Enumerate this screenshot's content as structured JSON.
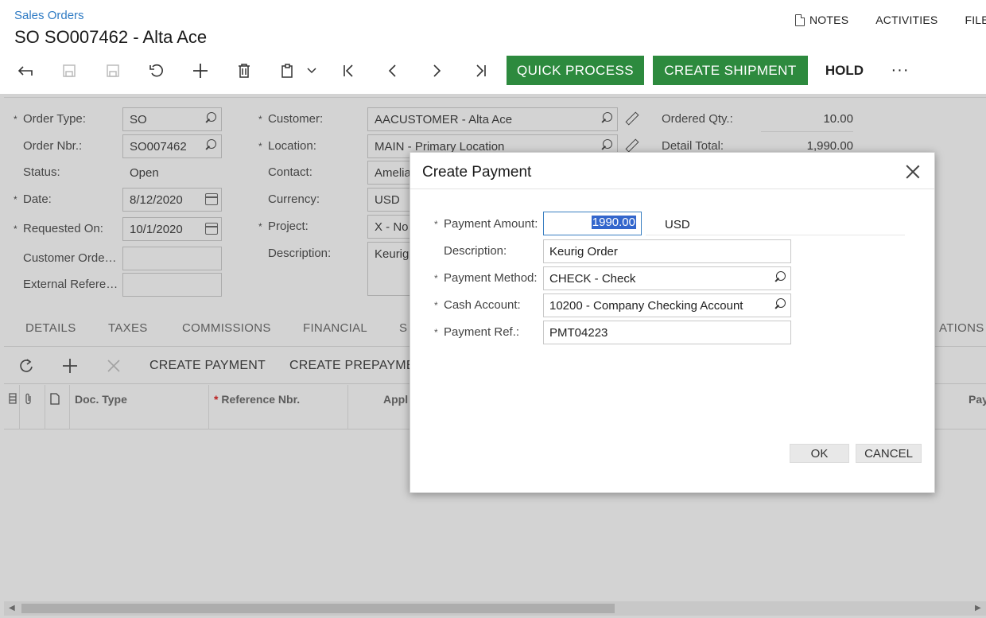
{
  "header": {
    "breadcrumb": "Sales Orders",
    "title": "SO SO007462 - Alta Ace",
    "links": {
      "notes": "NOTES",
      "activities": "ACTIVITIES",
      "files": "FILES"
    }
  },
  "toolbar": {
    "quick_process": "QUICK PROCESS",
    "create_shipment": "CREATE SHIPMENT",
    "hold": "HOLD",
    "more": "···"
  },
  "form": {
    "order_type_label": "Order Type:",
    "order_type": "SO",
    "order_nbr_label": "Order Nbr.:",
    "order_nbr": "SO007462",
    "status_label": "Status:",
    "status": "Open",
    "date_label": "Date:",
    "date": "8/12/2020",
    "requested_on_label": "Requested On:",
    "requested_on": "10/1/2020",
    "customer_order_label": "Customer Orde…",
    "external_ref_label": "External Refere…",
    "customer_label": "Customer:",
    "customer": "AACUSTOMER - Alta Ace",
    "location_label": "Location:",
    "location": "MAIN - Primary Location",
    "contact_label": "Contact:",
    "contact": "Amelia",
    "currency_label": "Currency:",
    "currency": "USD",
    "project_label": "Project:",
    "project": "X - No",
    "description_label": "Description:",
    "description": "Keurig",
    "ordered_qty_label": "Ordered Qty.:",
    "ordered_qty": "10.00",
    "detail_total_label": "Detail Total:",
    "detail_total": "1,990.00"
  },
  "tabs": [
    "DETAILS",
    "TAXES",
    "COMMISSIONS",
    "FINANCIAL",
    "S",
    "ATIONS"
  ],
  "grid_toolbar": {
    "create_payment": "CREATE PAYMENT",
    "create_prepayment": "CREATE PREPAYME"
  },
  "grid_columns": {
    "doc_type": "Doc. Type",
    "reference_nbr": "Reference Nbr.",
    "appl": "Appl",
    "pay": "Pay"
  },
  "dialog": {
    "title": "Create Payment",
    "payment_amount_label": "Payment Amount:",
    "payment_amount": "1990.00",
    "currency": "USD",
    "description_label": "Description:",
    "description": "Keurig Order",
    "payment_method_label": "Payment Method:",
    "payment_method": "CHECK - Check",
    "cash_account_label": "Cash Account:",
    "cash_account": "10200 - Company Checking Account",
    "payment_ref_label": "Payment Ref.:",
    "payment_ref": "PMT04223",
    "ok": "OK",
    "cancel": "CANCEL"
  }
}
